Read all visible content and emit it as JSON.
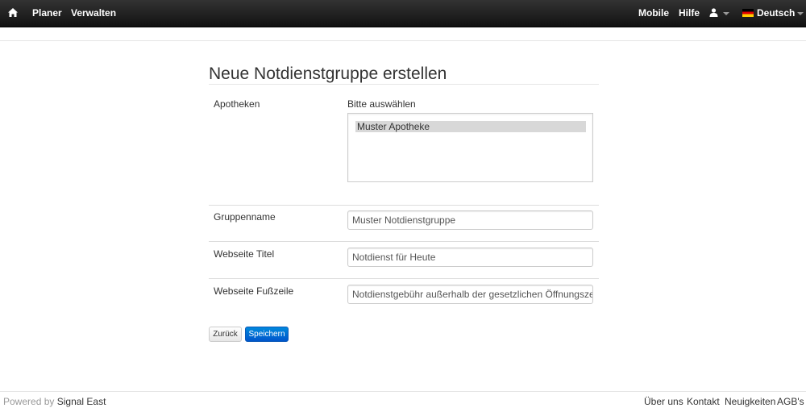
{
  "nav": {
    "home_icon": "home-icon",
    "left_items": [
      "Planer",
      "Verwalten"
    ],
    "right_items": [
      "Mobile",
      "Hilfe"
    ],
    "user_icon": "user-icon",
    "language": "Deutsch"
  },
  "page": {
    "title": "Neue Notdienstgruppe erstellen"
  },
  "form": {
    "pharmacies_label": "Apotheken",
    "pharmacies_hint": "Bitte auswählen",
    "pharmacies_options": [
      "Muster Apotheke"
    ],
    "group_name_label": "Gruppenname",
    "group_name_value": "Muster Notdienstgruppe",
    "site_title_label": "Webseite Titel",
    "site_title_value": "Notdienst für Heute",
    "site_footer_label": "Webseite Fußzeile",
    "site_footer_value": "Notdienstgebühr außerhalb der gesetzlichen Öffnungszeiten"
  },
  "buttons": {
    "back": "Zurück",
    "save": "Speichern"
  },
  "footer": {
    "powered_prefix": "Powered by",
    "powered_brand": "Signal East",
    "links": [
      "Über uns",
      "Kontakt",
      "Neuigkeiten",
      "AGB's"
    ]
  },
  "colors": {
    "navbar": "#222222",
    "primary_button": "#0074cc"
  }
}
